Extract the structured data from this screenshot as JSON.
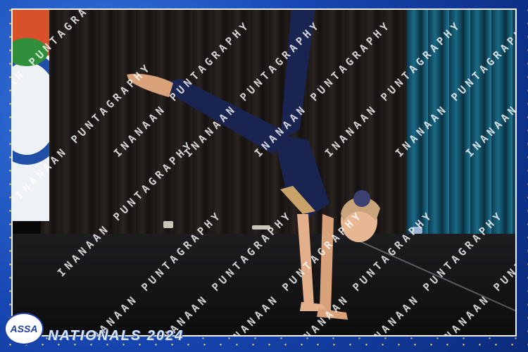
{
  "image": {
    "event_caption": "NATIONALS 2024",
    "logo_text": "ASSA",
    "watermark_text": "INANAAN PUNTAGRAPHY",
    "colors": {
      "frame_blue": "#1747b3",
      "sparkle_gold": "#ffdc5a",
      "costume_navy": "#1a2450",
      "curtain_teal": "#1a6a86"
    }
  }
}
